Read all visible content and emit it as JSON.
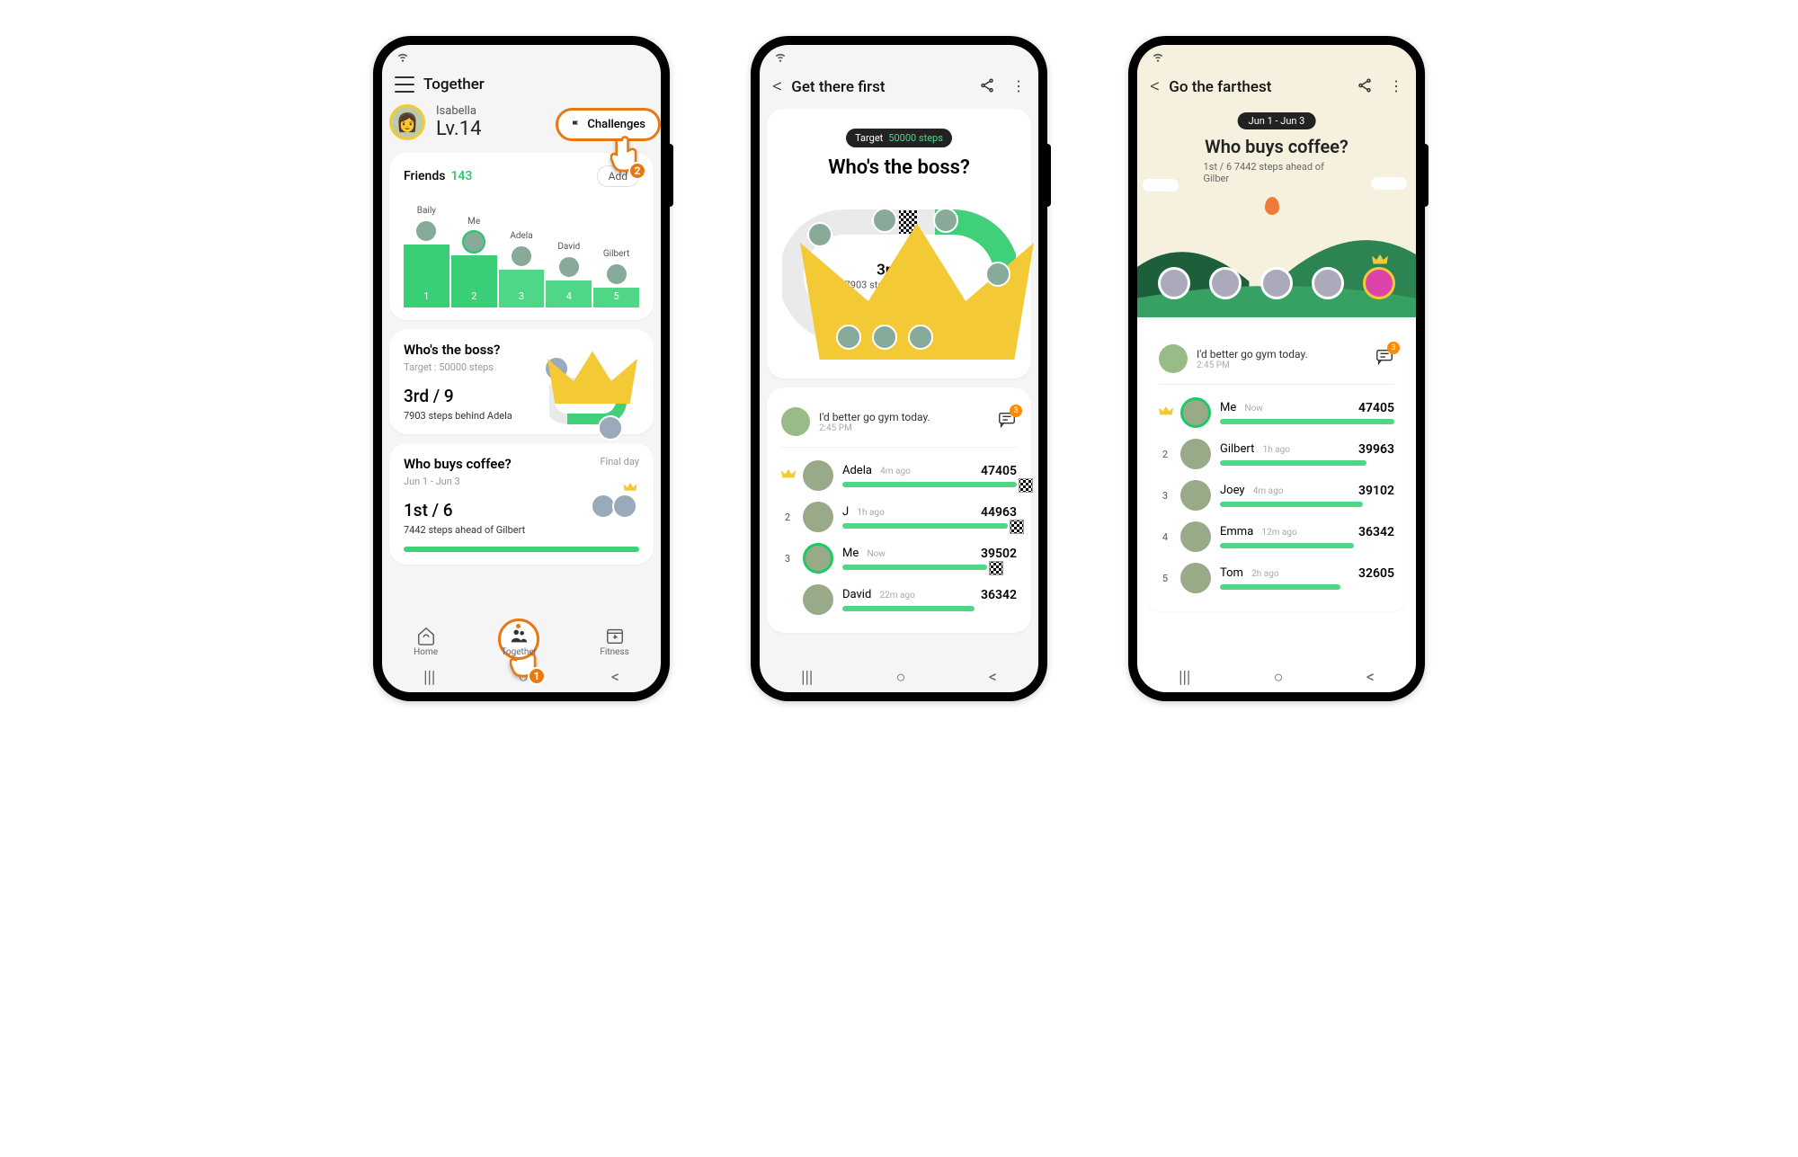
{
  "screen1": {
    "header_title": "Together",
    "user_name": "Isabella",
    "user_level": "Lv.14",
    "challenges_btn": "Challenges",
    "friends_label": "Friends",
    "friends_count": "143",
    "add_btn": "Add",
    "friends_bars": [
      {
        "name": "Baily",
        "rank": "1"
      },
      {
        "name": "Me",
        "rank": "2"
      },
      {
        "name": "Adela",
        "rank": "3"
      },
      {
        "name": "David",
        "rank": "4"
      },
      {
        "name": "Gilbert",
        "rank": "5"
      }
    ],
    "challenge_a": {
      "title": "Who's the boss?",
      "subtitle": "Target : 50000 steps",
      "rank": "3rd / 9",
      "behind": "7903 steps behind Adela"
    },
    "challenge_b": {
      "title": "Who buys coffee?",
      "dates": "Jun 1 - Jun 3",
      "badge": "Final day",
      "rank": "1st / 6",
      "ahead": "7442 steps ahead of Gilbert"
    },
    "nav": {
      "home": "Home",
      "together": "Together",
      "fitness": "Fitness"
    },
    "pointer_1": "1",
    "pointer_2": "2"
  },
  "screen2": {
    "header_title": "Get there first",
    "target_label": "Target",
    "target_value": "50000 steps",
    "center_title": "Who's the boss?",
    "center_rank": "3rd / 9",
    "center_sub": "7903 steps behind Adela",
    "message": "I'd better go gym today.",
    "message_time": "2:45 PM",
    "message_badge": "3",
    "leaderboard": [
      {
        "rank": "",
        "name": "Adela",
        "ago": "4m ago",
        "steps": "47405",
        "pct": 100,
        "crown": true,
        "chk": true
      },
      {
        "rank": "2",
        "name": "J",
        "ago": "1h ago",
        "steps": "44963",
        "pct": 95,
        "chk": true
      },
      {
        "rank": "3",
        "name": "Me",
        "ago": "Now",
        "steps": "39502",
        "pct": 83,
        "me": true,
        "chk": true
      },
      {
        "rank": "",
        "name": "David",
        "ago": "22m ago",
        "steps": "36342",
        "pct": 76
      }
    ]
  },
  "screen3": {
    "header_title": "Go the farthest",
    "date_pill": "Jun 1 - Jun 3",
    "title": "Who buys coffee?",
    "subtitle": "1st / 6   7442 steps ahead of Gilber",
    "message": "I'd better go gym today.",
    "message_time": "2:45 PM",
    "message_badge": "3",
    "leaderboard": [
      {
        "rank": "",
        "name": "Me",
        "ago": "Now",
        "steps": "47405",
        "pct": 100,
        "crown": true,
        "me": true
      },
      {
        "rank": "2",
        "name": "Gilbert",
        "ago": "1h ago",
        "steps": "39963",
        "pct": 84
      },
      {
        "rank": "3",
        "name": "Joey",
        "ago": "4m ago",
        "steps": "39102",
        "pct": 82
      },
      {
        "rank": "4",
        "name": "Emma",
        "ago": "12m ago",
        "steps": "36342",
        "pct": 77
      },
      {
        "rank": "5",
        "name": "Tom",
        "ago": "2h ago",
        "steps": "32605",
        "pct": 69
      }
    ]
  }
}
